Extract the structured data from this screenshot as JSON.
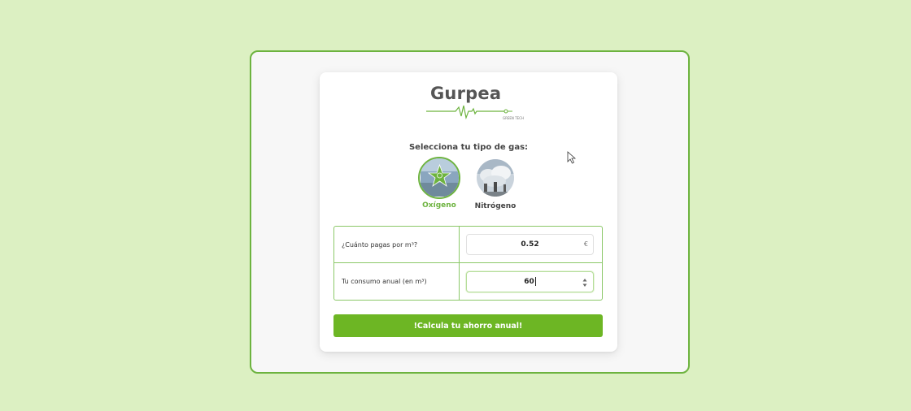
{
  "brand": {
    "name": "Gurpea",
    "tagline": "GREEN TECH",
    "accent": "#6db33f"
  },
  "gas_selector": {
    "title": "Selecciona tu tipo de gas:",
    "options": [
      {
        "label": "Oxígeno",
        "selected": true,
        "icon": "oxygen-star-icon"
      },
      {
        "label": "Nitrógeno",
        "selected": false,
        "icon": "nitrogen-tanks-image"
      }
    ]
  },
  "form": {
    "price": {
      "label": "¿Cuánto pagas por m³?",
      "value": "0.52",
      "unit": "€"
    },
    "consumption": {
      "label": "Tu consumo anual (en m³)",
      "value": "60"
    }
  },
  "submit": {
    "label": "!Calcula tu ahorro anual!"
  },
  "colors": {
    "button": "#6db624",
    "page_bg": "#dcf0c2",
    "border": "#8bc868"
  }
}
